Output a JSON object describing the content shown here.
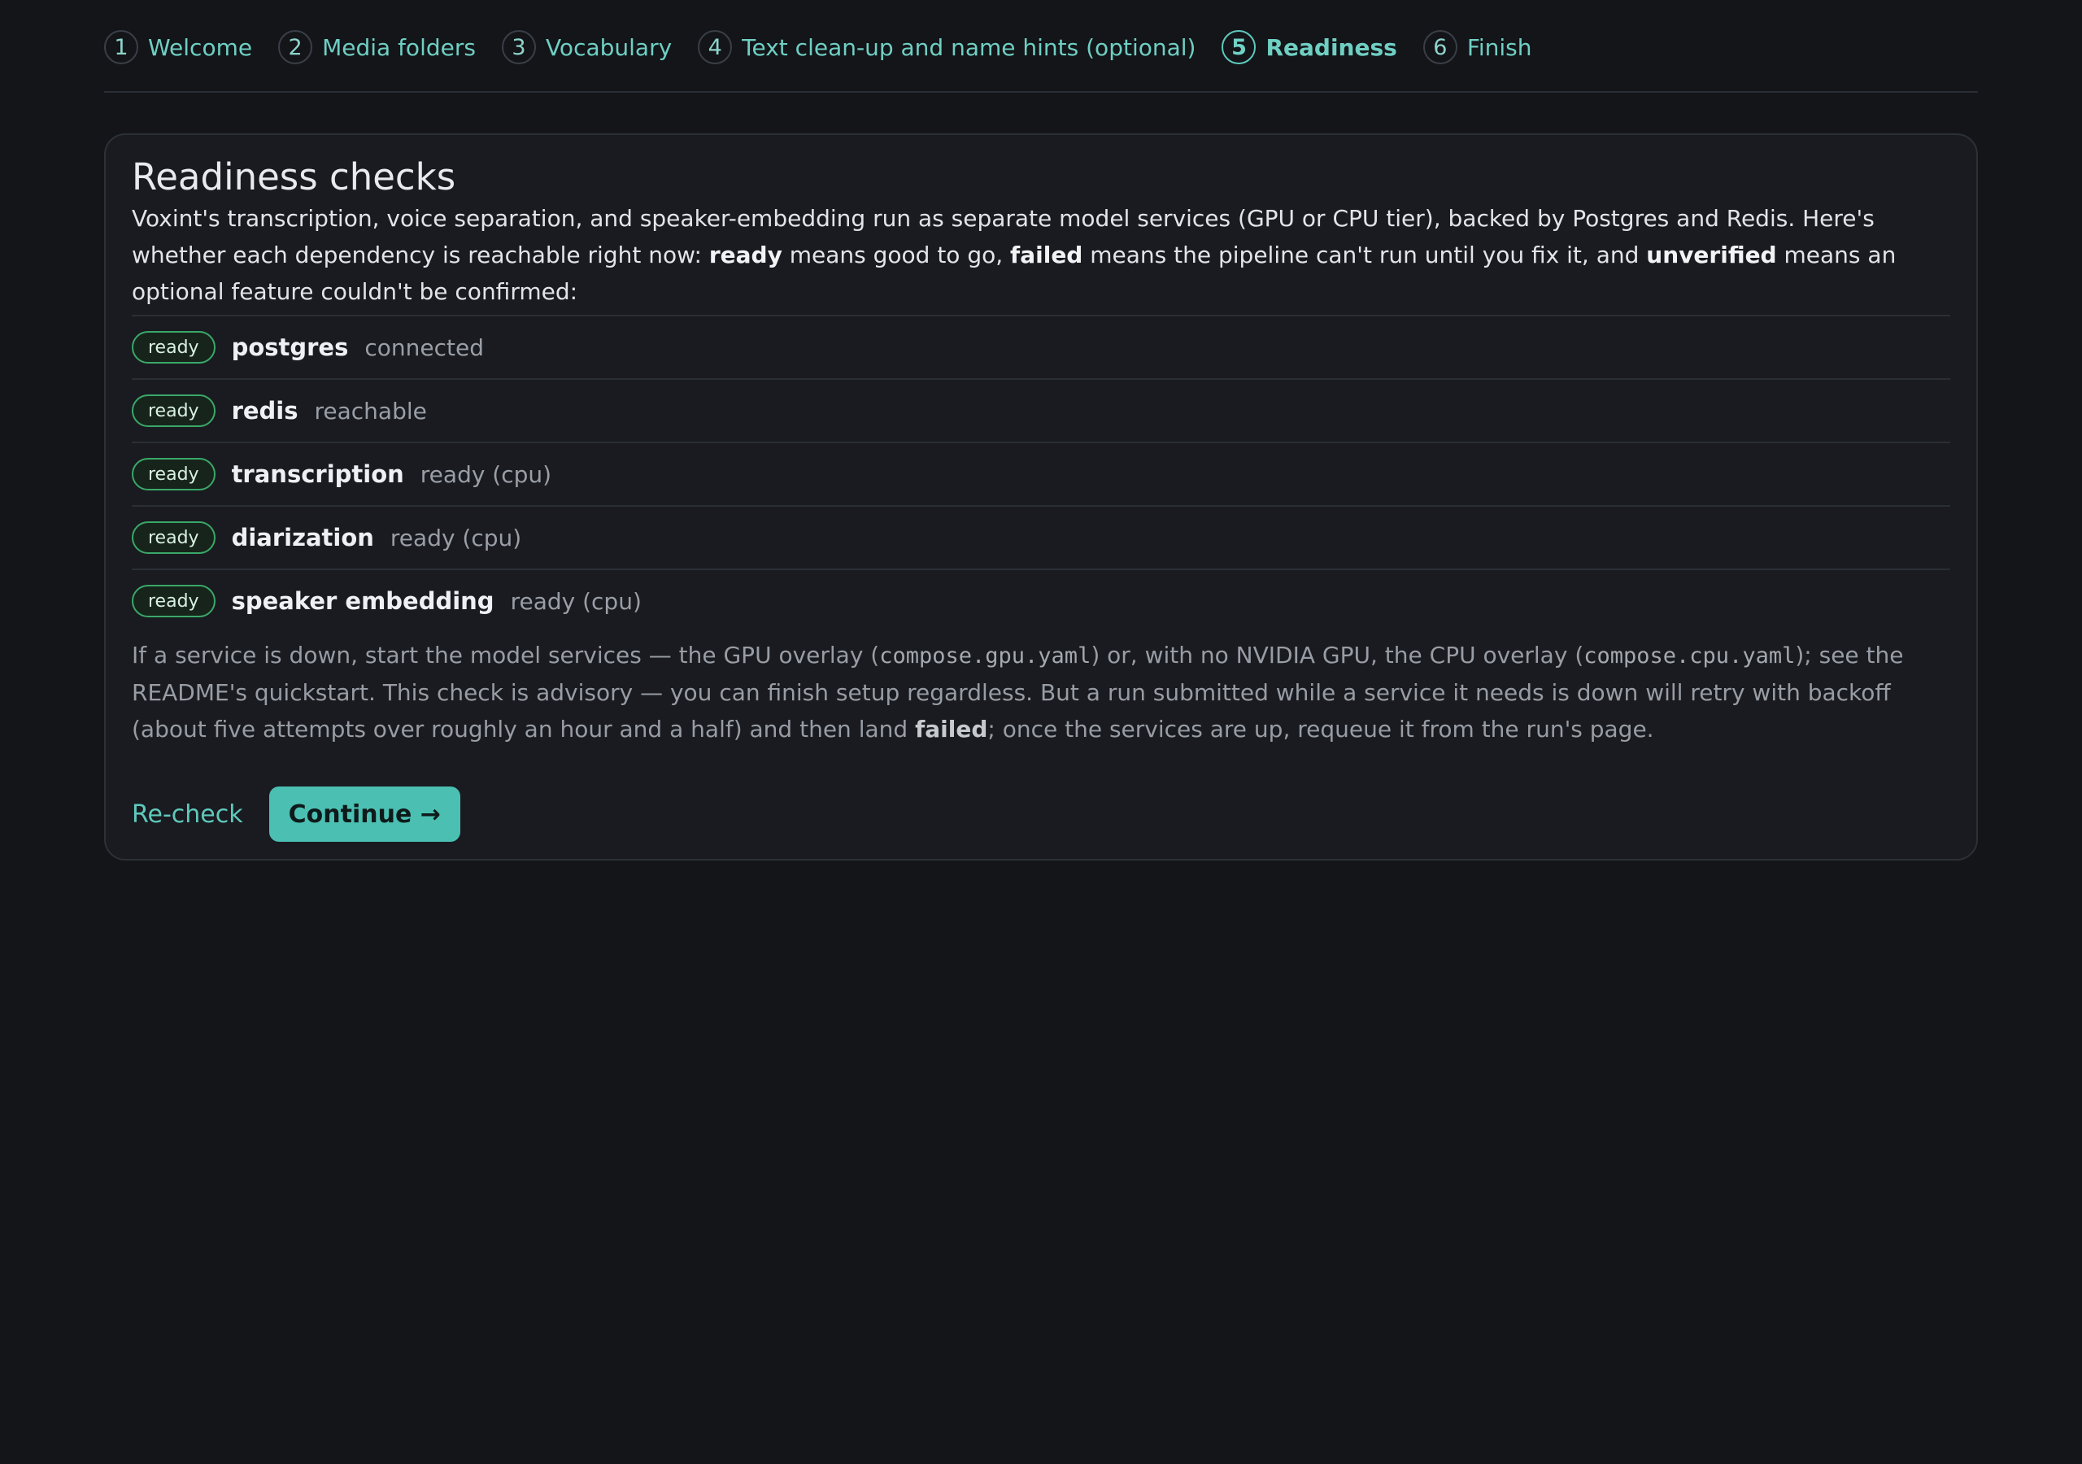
{
  "stepper": {
    "steps": [
      {
        "num": "1",
        "label": "Welcome"
      },
      {
        "num": "2",
        "label": "Media folders"
      },
      {
        "num": "3",
        "label": "Vocabulary"
      },
      {
        "num": "4",
        "label": "Text clean-up and name hints (optional)"
      },
      {
        "num": "5",
        "label": "Readiness"
      },
      {
        "num": "6",
        "label": "Finish"
      }
    ],
    "active_step": "5"
  },
  "card": {
    "title": "Readiness checks",
    "intro": {
      "p1": "Voxint's transcription, voice separation, and speaker-embedding run as separate model services (GPU or CPU tier), backed by Postgres and Redis. Here's whether each dependency is reachable right now: ",
      "ready_term": "ready",
      "p2": " means good to go, ",
      "failed_term": "failed",
      "p3": " means the pipeline can't run until you fix it, and ",
      "unverified_term": "unverified",
      "p4": " means an optional feature couldn't be confirmed:"
    },
    "checks": [
      {
        "status": "ready",
        "name": "postgres",
        "detail": "connected"
      },
      {
        "status": "ready",
        "name": "redis",
        "detail": "reachable"
      },
      {
        "status": "ready",
        "name": "transcription",
        "detail": "ready (cpu)"
      },
      {
        "status": "ready",
        "name": "diarization",
        "detail": "ready (cpu)"
      },
      {
        "status": "ready",
        "name": "speaker embedding",
        "detail": "ready (cpu)"
      }
    ],
    "note": {
      "p1": "If a service is down, start the model services — the GPU overlay (",
      "code1": "compose.gpu.yaml",
      "p2": ") or, with no NVIDIA GPU, the CPU overlay (",
      "code2": "compose.cpu.yaml",
      "p3": "); see the README's quickstart. This check is advisory — you can finish setup regardless. But a run submitted while a service it needs is down will retry with backoff (about five attempts over roughly an hour and a half) and then land ",
      "failed_term": "failed",
      "p4": "; once the services are up, requeue it from the run's page."
    },
    "actions": {
      "recheck_label": "Re-check",
      "continue_label": "Continue →"
    }
  },
  "colors": {
    "background": "#131519",
    "card": "#191b20",
    "accent": "#4bbfb2",
    "ready_badge": "#3aa868"
  }
}
